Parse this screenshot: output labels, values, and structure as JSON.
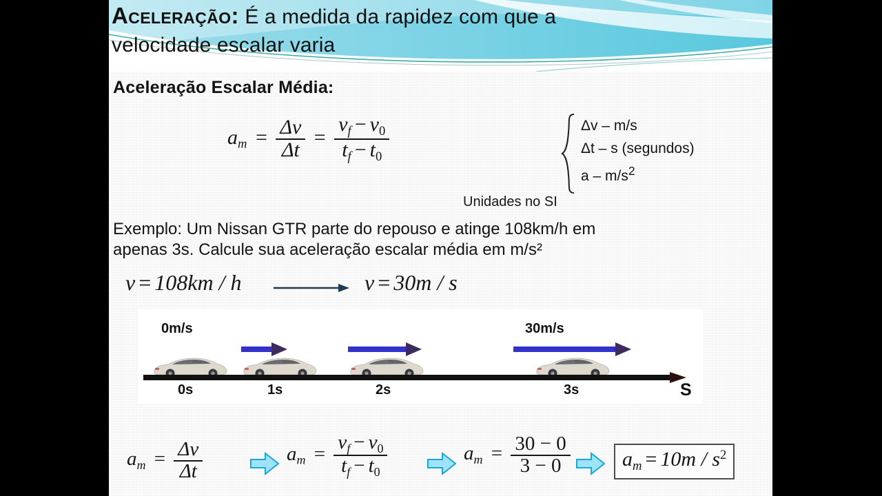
{
  "slide": {
    "title": {
      "lead": "Aceleração:",
      "rest": " É a medida da rapidez com que a",
      "line2": "velocidade escalar varia"
    },
    "subtitle": "Aceleração Escalar Média:",
    "main_formula": {
      "lhs_symbol": "a",
      "lhs_sub": "m",
      "equals": "=",
      "frac1_num": "Δv",
      "frac1_den": "Δt",
      "equals2": "=",
      "frac2_num_a": "v",
      "frac2_num_a_sub": "f",
      "frac2_num_minus": "−",
      "frac2_num_b": "v",
      "frac2_num_b_sub": "0",
      "frac2_den_a": "t",
      "frac2_den_a_sub": "f",
      "frac2_den_minus": "−",
      "frac2_den_b": "t",
      "frac2_den_b_sub": "0"
    },
    "units": {
      "line1": "Δv – m/s",
      "line2": "Δt – s (segundos)",
      "line3_a": "a  –  m/s",
      "line3_sup": "2",
      "caption": "Unidades no SI"
    },
    "example": {
      "line1": "Exemplo: Um Nissan GTR parte do repouso e atinge 108km/h em",
      "line2": "apenas 3s. Calcule sua aceleração escalar média em m/s²"
    },
    "conversion": {
      "left_v": "v",
      "left_eq": "=",
      "left_value": "108km / h",
      "right_v": "v",
      "right_eq": "=",
      "right_value": "30m / s",
      "arrow": "right-arrow-icon"
    },
    "diagram": {
      "axis_label": "S",
      "axis_arrow": "axis-arrowhead-icon",
      "time_labels": [
        "0s",
        "1s",
        "2s",
        "3s"
      ],
      "speed_labels": [
        {
          "text": "0m/s",
          "at": "0s"
        },
        {
          "text": "30m/s",
          "at": "3s"
        }
      ],
      "cars": 4,
      "velocity_arrows": 3,
      "arrow_color": "#3333cc",
      "car_color": "#ded8cf"
    },
    "calculation": {
      "step1": {
        "lhs": "a",
        "lhs_sub": "m",
        "eq": "=",
        "num": "Δv",
        "den": "Δt"
      },
      "step2": {
        "lhs": "a",
        "lhs_sub": "m",
        "eq": "=",
        "num_a": "v",
        "num_a_sub": "f",
        "num_minus": "−",
        "num_b": "v",
        "num_b_sub": "0",
        "den_a": "t",
        "den_a_sub": "f",
        "den_minus": "−",
        "den_b": "t",
        "den_b_sub": "0"
      },
      "step3": {
        "lhs": "a",
        "lhs_sub": "m",
        "eq": "=",
        "num": "30 − 0",
        "den": "3 − 0"
      },
      "result": {
        "lhs": "a",
        "lhs_sub": "m",
        "eq": "=",
        "value": "10m / s",
        "sup": "2"
      },
      "arrow_icon": "block-arrow-right-icon",
      "arrow_color": "#45c7ef"
    },
    "colors": {
      "header_wave_light": "#a9e2ef",
      "header_wave_mid": "#63cbdd",
      "header_wave_teal": "#2fa6a0",
      "slide_bg": "#fbfbfb",
      "letterbox": "#000000"
    }
  }
}
